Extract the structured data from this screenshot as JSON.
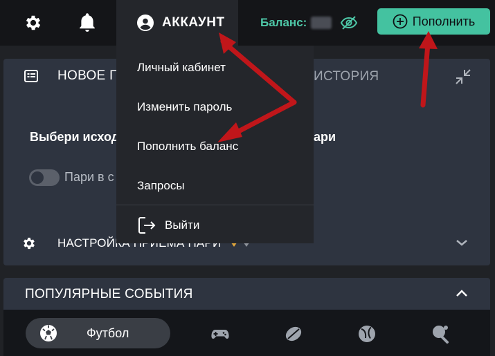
{
  "header": {
    "account_label": "АККАУНТ",
    "balance_label": "Баланс:",
    "topup_label": "Пополнить"
  },
  "account_menu": {
    "items": [
      {
        "label": "Личный кабинет"
      },
      {
        "label": "Изменить пароль"
      },
      {
        "label": "Пополнить баланс"
      },
      {
        "label": "Запросы"
      }
    ],
    "logout_label": "Выйти"
  },
  "bet_panel": {
    "tab_new": "НОВОЕ П",
    "tab_history": "ИСТОРИЯ",
    "prompt_left": "Выбери исход",
    "prompt_right": "ари",
    "toggle_label": "Пари в с",
    "settings_label": "НАСТРОЙКА ПРИЕМА ПАРИ"
  },
  "popular": {
    "title": "ПОПУЛЯРНЫЕ СОБЫТИЯ",
    "active_sport": "Футбол"
  },
  "colors": {
    "accent": "#44c2a0",
    "balance_text": "#4ec7a7",
    "annotation_arrow": "#c0161a"
  }
}
